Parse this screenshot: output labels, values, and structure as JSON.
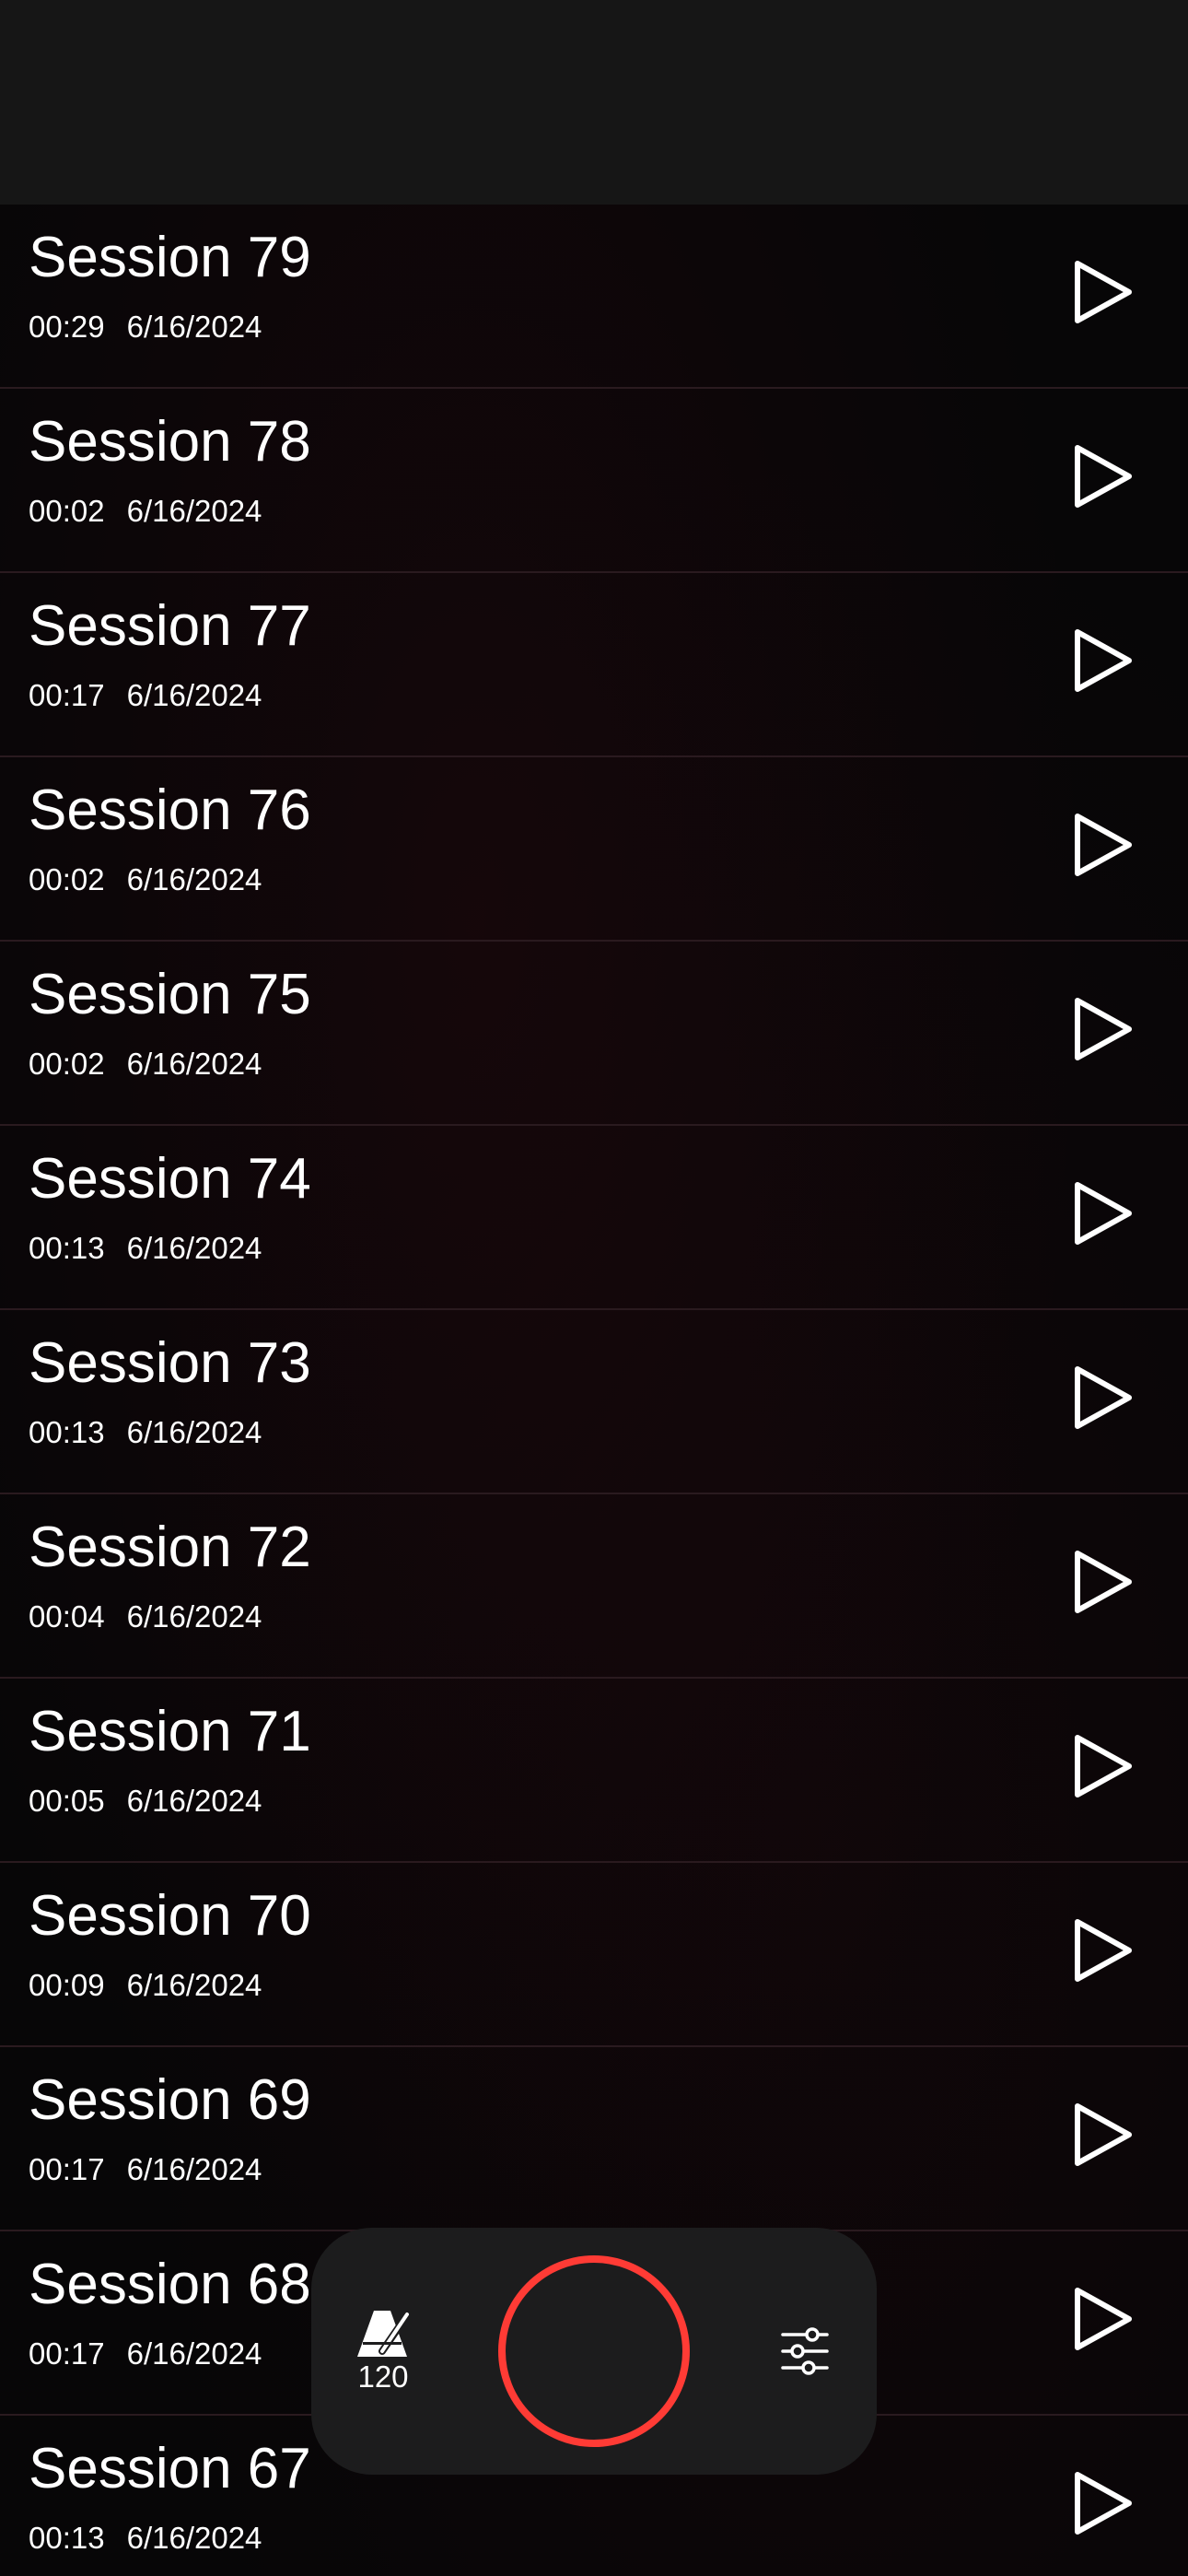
{
  "sessions": [
    {
      "title": "Session 79",
      "duration": "00:29",
      "date": "6/16/2024"
    },
    {
      "title": "Session 78",
      "duration": "00:02",
      "date": "6/16/2024"
    },
    {
      "title": "Session 77",
      "duration": "00:17",
      "date": "6/16/2024"
    },
    {
      "title": "Session 76",
      "duration": "00:02",
      "date": "6/16/2024"
    },
    {
      "title": "Session 75",
      "duration": "00:02",
      "date": "6/16/2024"
    },
    {
      "title": "Session 74",
      "duration": "00:13",
      "date": "6/16/2024"
    },
    {
      "title": "Session 73",
      "duration": "00:13",
      "date": "6/16/2024"
    },
    {
      "title": "Session 72",
      "duration": "00:04",
      "date": "6/16/2024"
    },
    {
      "title": "Session 71",
      "duration": "00:05",
      "date": "6/16/2024"
    },
    {
      "title": "Session 70",
      "duration": "00:09",
      "date": "6/16/2024"
    },
    {
      "title": "Session 69",
      "duration": "00:17",
      "date": "6/16/2024"
    },
    {
      "title": "Session 68",
      "duration": "00:17",
      "date": "6/16/2024"
    },
    {
      "title": "Session 67",
      "duration": "00:13",
      "date": "6/16/2024"
    }
  ],
  "row_icon": "play-icon",
  "control_bar": {
    "metronome_icon": "metronome-icon",
    "tempo": "120",
    "record_icon": "record-icon",
    "record_color": "#ff3b35",
    "settings_icon": "sliders-icon"
  },
  "colors": {
    "background": "#070607",
    "top_bar": "#161616",
    "control_bar": "#1c1c1d",
    "text": "#ffffff"
  }
}
